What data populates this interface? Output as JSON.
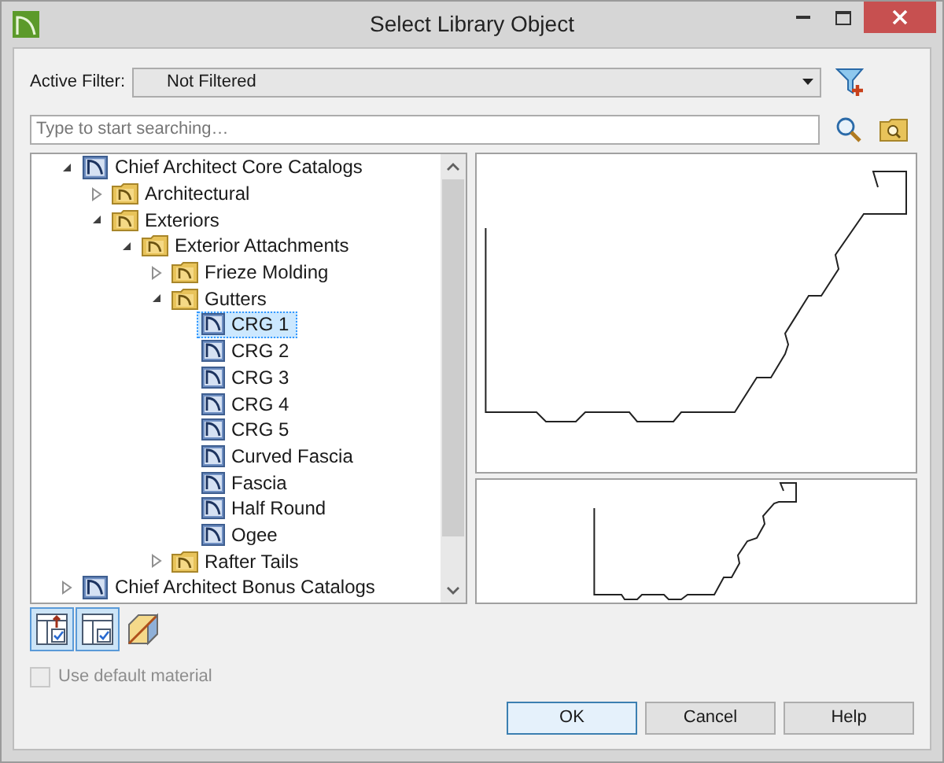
{
  "window": {
    "title": "Select Library Object"
  },
  "filter": {
    "label": "Active Filter:",
    "value": "Not Filtered"
  },
  "search": {
    "placeholder": "Type to start searching…"
  },
  "tree": [
    {
      "label": "Chief Architect Core Catalogs",
      "kind": "library",
      "expanded": true,
      "selected": false,
      "children": [
        {
          "label": "Architectural",
          "kind": "folder",
          "expanded": false,
          "selected": false
        },
        {
          "label": "Exteriors",
          "kind": "folder",
          "expanded": true,
          "selected": false,
          "children": [
            {
              "label": "Exterior Attachments",
              "kind": "folder",
              "expanded": true,
              "selected": false,
              "children": [
                {
                  "label": "Frieze Molding",
                  "kind": "folder",
                  "expanded": false,
                  "selected": false
                },
                {
                  "label": "Gutters",
                  "kind": "folder",
                  "expanded": true,
                  "selected": false,
                  "children": [
                    {
                      "label": "CRG  1",
                      "kind": "object",
                      "selected": true
                    },
                    {
                      "label": "CRG  2",
                      "kind": "object",
                      "selected": false
                    },
                    {
                      "label": "CRG  3",
                      "kind": "object",
                      "selected": false
                    },
                    {
                      "label": "CRG  4",
                      "kind": "object",
                      "selected": false
                    },
                    {
                      "label": "CRG  5",
                      "kind": "object",
                      "selected": false
                    },
                    {
                      "label": "Curved Fascia",
                      "kind": "object",
                      "selected": false
                    },
                    {
                      "label": "Fascia",
                      "kind": "object",
                      "selected": false
                    },
                    {
                      "label": "Half Round",
                      "kind": "object",
                      "selected": false
                    },
                    {
                      "label": "Ogee",
                      "kind": "object",
                      "selected": false
                    }
                  ]
                },
                {
                  "label": "Rafter Tails",
                  "kind": "folder",
                  "expanded": false,
                  "selected": false
                }
              ]
            }
          ]
        }
      ]
    },
    {
      "label": "Chief Architect Bonus Catalogs",
      "kind": "library",
      "expanded": false,
      "selected": false
    }
  ],
  "view_buttons": [
    {
      "kind": "parent",
      "selected": true
    },
    {
      "kind": "child",
      "selected": true
    },
    {
      "kind": "material",
      "selected": false
    }
  ],
  "use_default_material": {
    "label": "Use default material",
    "checked": false,
    "disabled": true
  },
  "buttons": [
    {
      "label": "OK",
      "default": true
    },
    {
      "label": "Cancel",
      "default": false
    },
    {
      "label": "Help",
      "default": false
    }
  ]
}
